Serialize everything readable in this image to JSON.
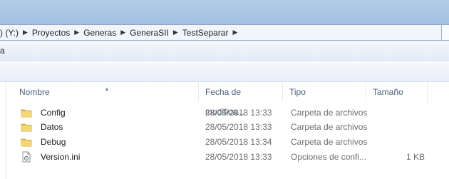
{
  "address": {
    "crumbs": [
      ") (Y:)",
      "Proyectos",
      "Generas",
      "GeneraSII",
      "TestSeparar"
    ]
  },
  "menu": {
    "partial_label": "a"
  },
  "columns": {
    "name": "Nombre",
    "date": "Fecha de modifica...",
    "type": "Tipo",
    "size": "Tamaño"
  },
  "files": [
    {
      "name": "Config",
      "date": "28/05/2018 13:33",
      "type": "Carpeta de archivos",
      "size": "",
      "icon": "folder-icon"
    },
    {
      "name": "Datos",
      "date": "28/05/2018 13:33",
      "type": "Carpeta de archivos",
      "size": "",
      "icon": "folder-icon"
    },
    {
      "name": "Debug",
      "date": "28/05/2018 13:34",
      "type": "Carpeta de archivos",
      "size": "",
      "icon": "folder-icon"
    },
    {
      "name": "Version.ini",
      "date": "28/05/2018 13:33",
      "type": "Opciones de confi...",
      "size": "1 KB",
      "icon": "ini-file-icon"
    }
  ],
  "colors": {
    "titlebar": "#a9c5e3",
    "header_text": "#4c607a",
    "folder": "#e8c34e"
  }
}
